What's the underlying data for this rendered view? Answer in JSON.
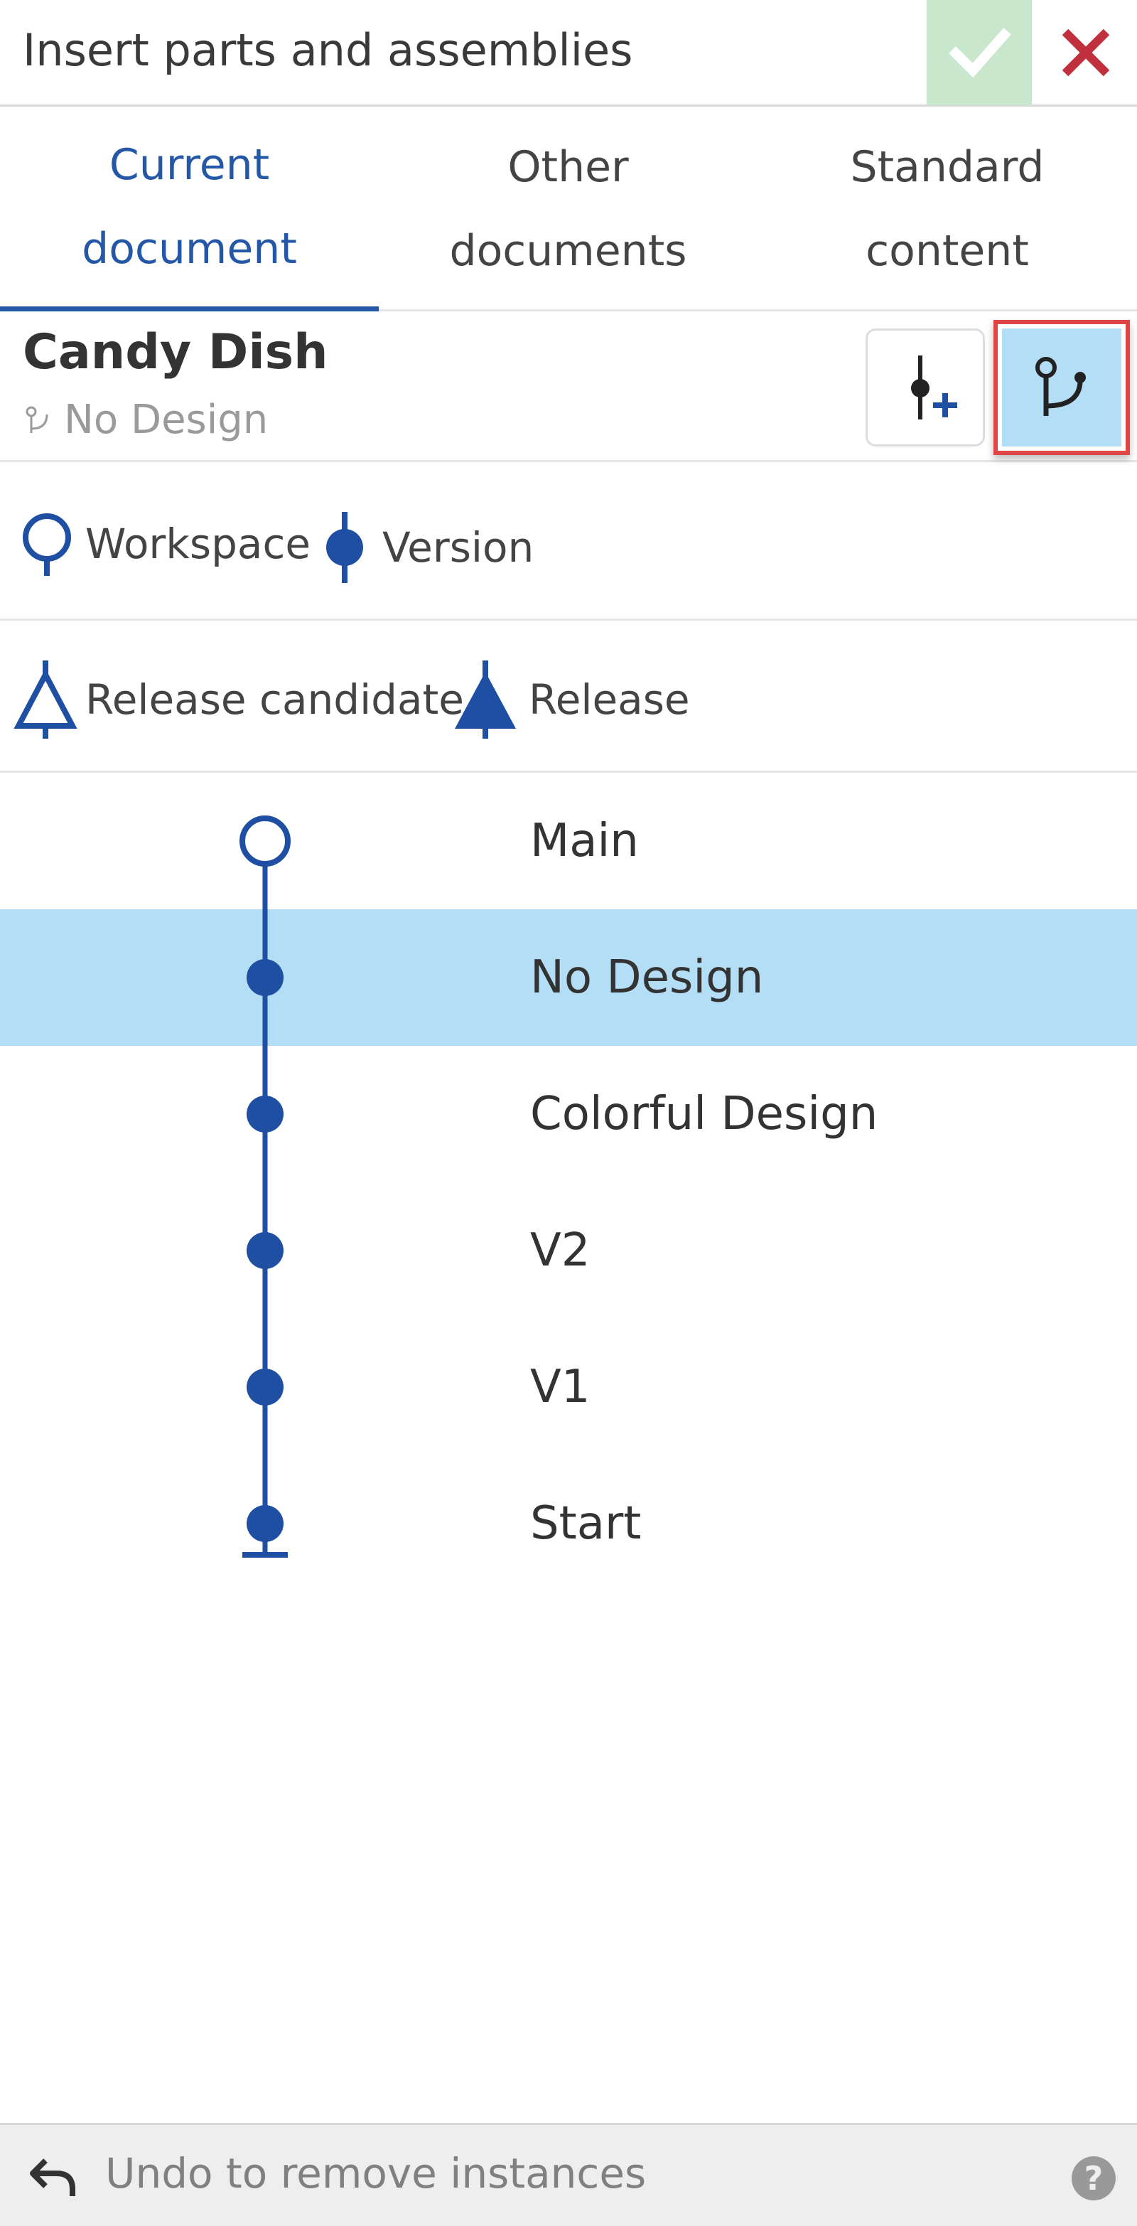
{
  "header": {
    "title": "Insert parts and assemblies",
    "ok_icon": "check-icon",
    "close_icon": "close-icon",
    "ok_color": "#c8e7cc",
    "close_color": "#c0303c"
  },
  "tabs": [
    {
      "line1": "Current",
      "line2": "document",
      "active": true
    },
    {
      "line1": "Other",
      "line2": "documents",
      "active": false
    },
    {
      "line1": "Standard",
      "line2": "content",
      "active": false
    }
  ],
  "document": {
    "title": "Candy Dish",
    "branch_icon": "branch-icon",
    "current": "No Design",
    "actions": [
      {
        "icon": "insert-version-icon"
      },
      {
        "icon": "branch-icon",
        "highlighted": true
      }
    ]
  },
  "legend": {
    "workspace": "Workspace",
    "version": "Version",
    "release_candidate": "Release candidate",
    "release": "Release"
  },
  "graph": {
    "accent": "#1e4fa3",
    "selected_color": "#b3def5",
    "nodes": [
      {
        "label": "Main",
        "type": "workspace",
        "selected": false
      },
      {
        "label": "No Design",
        "type": "version",
        "selected": true
      },
      {
        "label": "Colorful Design",
        "type": "version",
        "selected": false
      },
      {
        "label": "V2",
        "type": "version",
        "selected": false
      },
      {
        "label": "V1",
        "type": "version",
        "selected": false
      },
      {
        "label": "Start",
        "type": "start",
        "selected": false
      }
    ]
  },
  "footer": {
    "undo_label": "Undo to remove instances",
    "undo_icon": "undo-icon",
    "help_icon": "help-icon",
    "help_glyph": "?"
  }
}
